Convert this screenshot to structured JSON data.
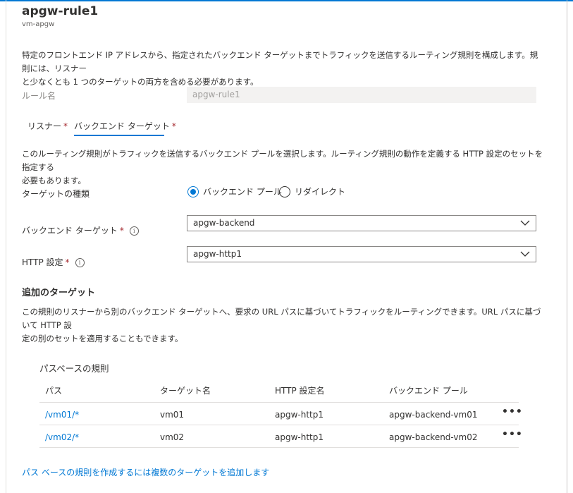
{
  "header": {
    "title": "apgw-rule1",
    "subtitle": "vm-apgw"
  },
  "intro": {
    "line1": "特定のフロントエンド IP アドレスから、指定されたバックエンド ターゲットまでトラフィックを送信するルーティング規則を構成します。規則には、リスナー",
    "line2": "と少なくとも 1 つのターゲットの両方を含める必要があります。"
  },
  "rule_name": {
    "label": "ルール名",
    "value": "apgw-rule1"
  },
  "tabs": [
    {
      "label": "リスナー",
      "required": "*"
    },
    {
      "label": "バックエンド ターゲット",
      "required": "*"
    }
  ],
  "backend": {
    "desc_line1": "このルーティング規則がトラフィックを送信するバックエンド プールを選択します。ルーティング規則の動作を定義する HTTP 設定のセットを指定する",
    "desc_line2": "必要もあります。",
    "target_type_label": "ターゲットの種類",
    "options": [
      {
        "label": "バックエンド プール",
        "checked": true
      },
      {
        "label": "リダイレクト",
        "checked": false
      }
    ],
    "backend_target_label": "バックエンド ターゲット",
    "backend_target_value": "apgw-backend",
    "http_setting_label": "HTTP 設定",
    "http_setting_value": "apgw-http1",
    "required_mark": "*"
  },
  "additional": {
    "title": "追加のターゲット",
    "desc_line1": "この規則のリスナーから別のバックエンド ターゲットへ、要求の URL パスに基づいてトラフィックをルーティングできます。URL パスに基づいて HTTP 設",
    "desc_line2": "定の別のセットを適用することもできます。"
  },
  "path_rules": {
    "title": "パスベースの規則",
    "columns": [
      "パス",
      "ターゲット名",
      "HTTP 設定名",
      "バックエンド プール"
    ],
    "rows": [
      {
        "path": "/vm01/*",
        "target": "vm01",
        "http": "apgw-http1",
        "pool": "apgw-backend-vm01"
      },
      {
        "path": "/vm02/*",
        "target": "vm02",
        "http": "apgw-http1",
        "pool": "apgw-backend-vm02"
      }
    ],
    "more_symbol": "•••"
  },
  "footer_link": "パス ベースの規則を作成するには複数のターゲットを追加します",
  "colors": {
    "accent": "#0078d4",
    "required": "#a4262c"
  }
}
